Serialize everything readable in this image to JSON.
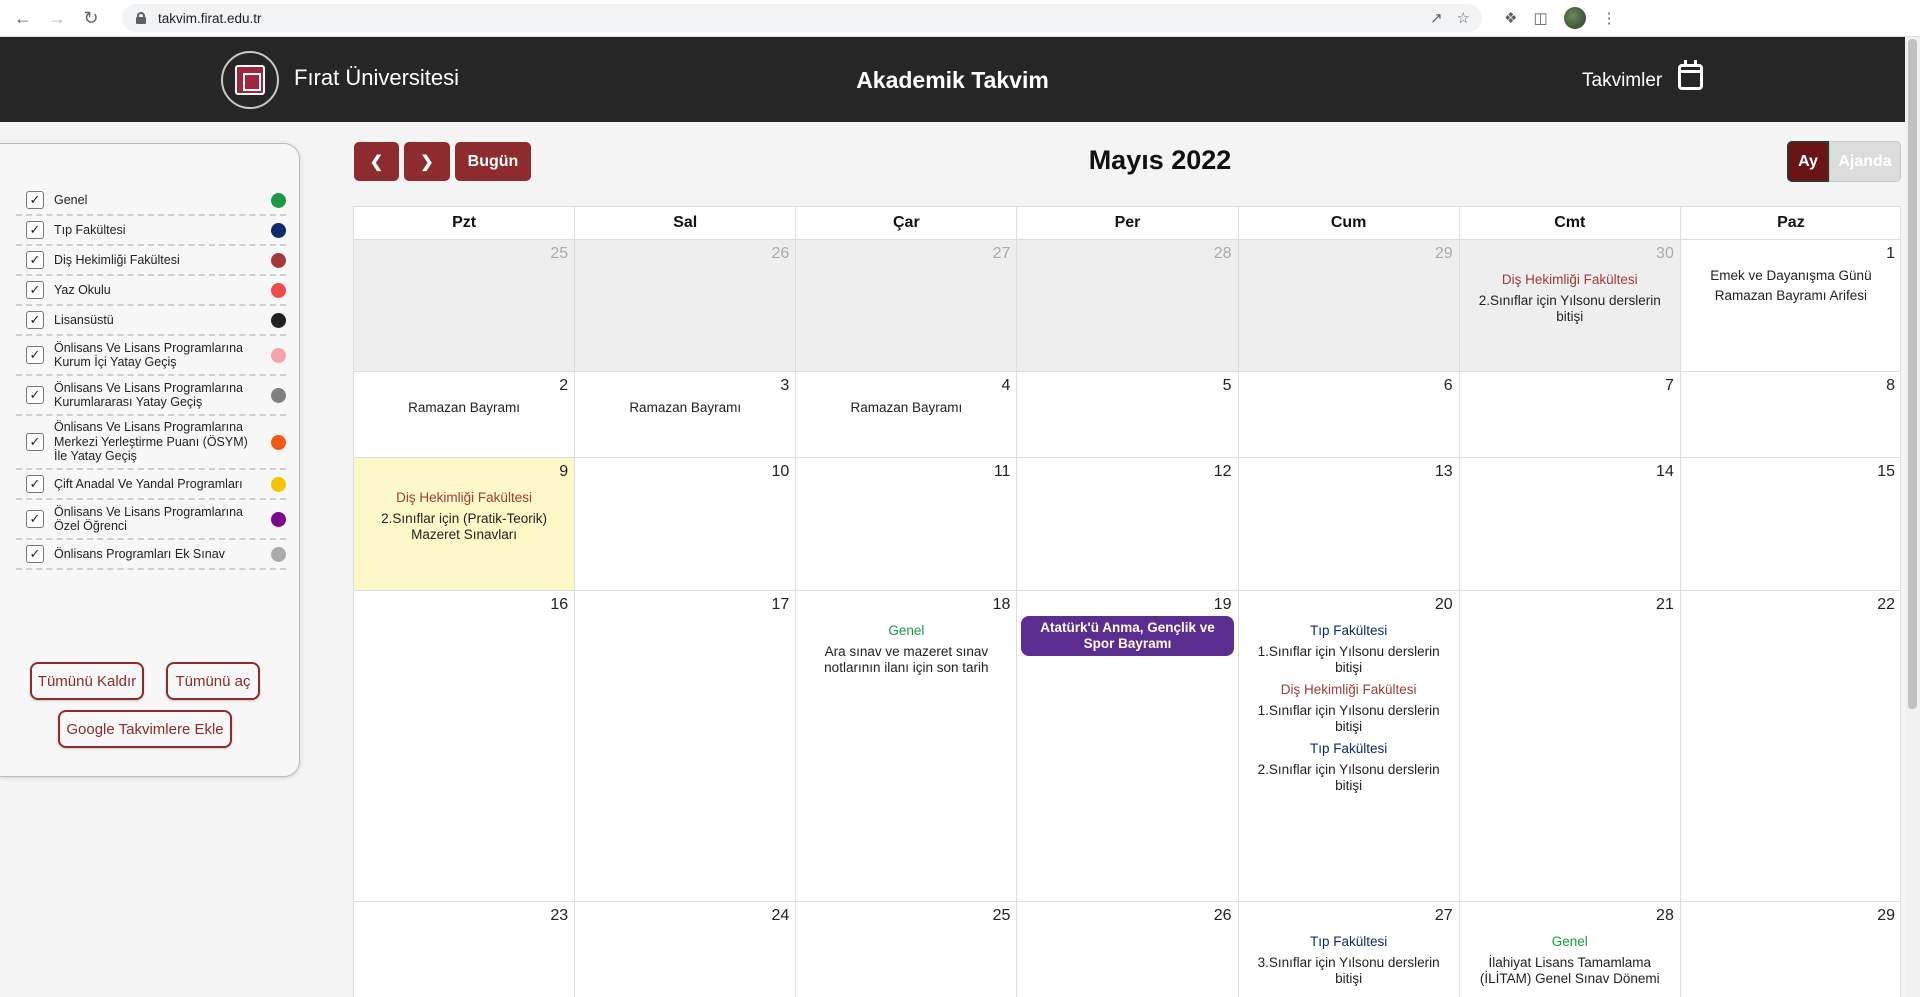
{
  "browser": {
    "url": "takvim.firat.edu.tr"
  },
  "header": {
    "university": "Fırat Üniversitesi",
    "title": "Akademik Takvim",
    "calendars_link": "Takvimler"
  },
  "sidebar": {
    "filters": [
      {
        "label": "Genel",
        "checked": true,
        "color": "#1a9a45"
      },
      {
        "label": "Tıp Fakültesi",
        "checked": true,
        "color": "#0d2a6b"
      },
      {
        "label": "Diş Hekimliği Fakültesi",
        "checked": true,
        "color": "#a33a3a"
      },
      {
        "label": "Yaz Okulu",
        "checked": true,
        "color": "#f04a4a"
      },
      {
        "label": "Lisansüstü",
        "checked": true,
        "color": "#222222"
      },
      {
        "label": "Önlisans Ve Lisans Programlarına Kurum İçi Yatay Geçiş",
        "checked": true,
        "color": "#f7a1ad"
      },
      {
        "label": "Önlisans Ve Lisans Programlarına Kurumlararası Yatay Geçiş",
        "checked": true,
        "color": "#808080"
      },
      {
        "label": "Önlisans Ve Lisans Programlarına Merkezi Yerleştirme Puanı (ÖSYM) İle Yatay Geçiş",
        "checked": true,
        "color": "#f05a14"
      },
      {
        "label": "Çift Anadal Ve Yandal Programları",
        "checked": true,
        "color": "#f5c400"
      },
      {
        "label": "Önlisans Ve Lisans Programlarına Özel Öğrenci",
        "checked": true,
        "color": "#7a0a8a"
      },
      {
        "label": "Önlisans Programları Ek Sınav",
        "checked": true,
        "color": "#aaaaaa"
      }
    ],
    "buttons": {
      "uncheck_all": "Tümünü Kaldır",
      "check_all": "Tümünü aç",
      "add_google": "Google Takvimlere Ekle"
    }
  },
  "toolbar": {
    "prev_icon": "chevron-left-icon",
    "next_icon": "chevron-right-icon",
    "today": "Bugün",
    "month_title": "Mayıs 2022",
    "view_month": "Ay",
    "view_agenda": "Ajanda"
  },
  "colors": {
    "genel": "#1a9a45",
    "tip": "#0d2a6b",
    "dis": "#a33a3a",
    "special": "#5b2d91",
    "accent": "#8d2b2e",
    "today_bg": "#fdf8c8"
  },
  "calendar": {
    "weekdays": [
      "Pzt",
      "Sal",
      "Çar",
      "Per",
      "Cum",
      "Cmt",
      "Paz"
    ],
    "weeks": [
      {
        "days": [
          {
            "num": "25",
            "other": true,
            "events": []
          },
          {
            "num": "26",
            "other": true,
            "events": []
          },
          {
            "num": "27",
            "other": true,
            "events": []
          },
          {
            "num": "28",
            "other": true,
            "events": []
          },
          {
            "num": "29",
            "other": true,
            "events": []
          },
          {
            "num": "30",
            "other": true,
            "events": [
              {
                "title": "Diş Hekimliği Fakültesi",
                "cat": "dis",
                "desc": "2.Sınıflar için Yılsonu derslerin bitişi"
              }
            ]
          },
          {
            "num": "1",
            "other": false,
            "events": [
              {
                "title": "",
                "cat": "",
                "desc": "Emek ve Dayanışma Günü"
              },
              {
                "title": "",
                "cat": "",
                "desc": "Ramazan Bayramı Arifesi"
              }
            ]
          }
        ]
      },
      {
        "days": [
          {
            "num": "2",
            "events": [
              {
                "title": "",
                "cat": "",
                "desc": "Ramazan Bayramı"
              }
            ]
          },
          {
            "num": "3",
            "events": [
              {
                "title": "",
                "cat": "",
                "desc": "Ramazan Bayramı"
              }
            ]
          },
          {
            "num": "4",
            "events": [
              {
                "title": "",
                "cat": "",
                "desc": "Ramazan Bayramı"
              }
            ]
          },
          {
            "num": "5",
            "events": []
          },
          {
            "num": "6",
            "events": []
          },
          {
            "num": "7",
            "events": []
          },
          {
            "num": "8",
            "events": []
          }
        ]
      },
      {
        "days": [
          {
            "num": "9",
            "today": true,
            "events": [
              {
                "title": "Diş Hekimliği Fakültesi",
                "cat": "dis",
                "desc": "2.Sınıflar için (Pratik-Teorik) Mazeret Sınavları"
              }
            ]
          },
          {
            "num": "10",
            "events": []
          },
          {
            "num": "11",
            "events": []
          },
          {
            "num": "12",
            "events": []
          },
          {
            "num": "13",
            "events": []
          },
          {
            "num": "14",
            "events": []
          },
          {
            "num": "15",
            "events": []
          }
        ]
      },
      {
        "days": [
          {
            "num": "16",
            "events": []
          },
          {
            "num": "17",
            "events": []
          },
          {
            "num": "18",
            "events": [
              {
                "title": "Genel",
                "cat": "genel",
                "desc": "Ara sınav ve mazeret sınav notlarının ilanı için son tarih"
              }
            ]
          },
          {
            "num": "19",
            "events": [
              {
                "pill": "Atatürk'ü Anma, Gençlik ve Spor Bayramı"
              }
            ]
          },
          {
            "num": "20",
            "events": [
              {
                "title": "Tıp Fakültesi",
                "cat": "tip",
                "desc": "1.Sınıflar için Yılsonu derslerin bitişi"
              },
              {
                "title": "Diş Hekimliği Fakültesi",
                "cat": "dis",
                "desc": "1.Sınıflar için Yılsonu derslerin bitişi"
              },
              {
                "title": "Tıp Fakültesi",
                "cat": "tip",
                "desc": "2.Sınıflar için  Yılsonu derslerin bitişi"
              }
            ]
          },
          {
            "num": "21",
            "events": []
          },
          {
            "num": "22",
            "events": []
          }
        ]
      },
      {
        "days": [
          {
            "num": "23",
            "events": []
          },
          {
            "num": "24",
            "events": []
          },
          {
            "num": "25",
            "events": []
          },
          {
            "num": "26",
            "events": []
          },
          {
            "num": "27",
            "events": [
              {
                "title": "Tıp Fakültesi",
                "cat": "tip",
                "desc": "3.Sınıflar için Yılsonu derslerin bitişi"
              }
            ]
          },
          {
            "num": "28",
            "events": [
              {
                "title": "Genel",
                "cat": "genel",
                "desc": "İlahiyat Lisans Tamamlama (İLİTAM) Genel Sınav Dönemi"
              }
            ]
          },
          {
            "num": "29",
            "events": []
          }
        ]
      }
    ]
  }
}
